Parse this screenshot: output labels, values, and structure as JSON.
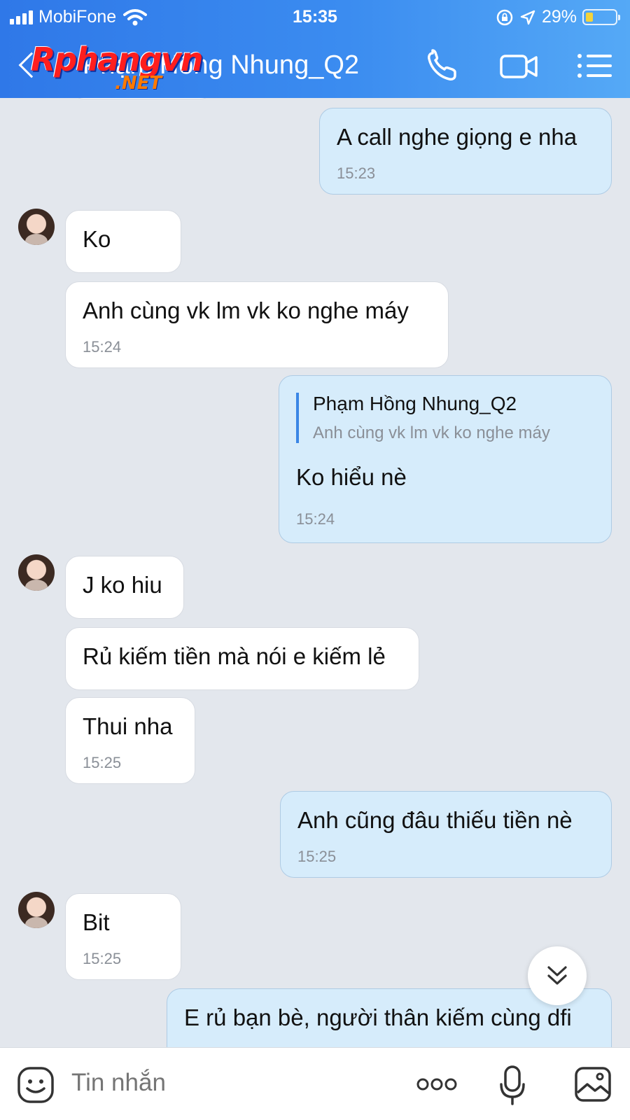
{
  "status_bar": {
    "carrier": "MobiFone",
    "time": "15:35",
    "battery": "29%"
  },
  "header": {
    "title": "Phạm Hồng Nhung_Q2",
    "watermark_main": "Rphangvn",
    "watermark_sub": ".NET"
  },
  "messages": [
    {
      "side": "out",
      "text": "A call nghe giọng e nha",
      "time": "15:23"
    },
    {
      "side": "in",
      "text": "Ko"
    },
    {
      "side": "in",
      "text": "Anh cùng vk lm vk ko nghe máy",
      "time": "15:24"
    },
    {
      "side": "out",
      "quote_name": "Phạm Hồng Nhung_Q2",
      "quote_text": "Anh cùng vk lm vk ko nghe máy",
      "text": "Ko hiểu nè",
      "time": "15:24"
    },
    {
      "side": "in",
      "text": "J ko hiu"
    },
    {
      "side": "in",
      "text": "Rủ kiếm tiền mà nói e kiếm lẻ"
    },
    {
      "side": "in",
      "text": "Thui nha",
      "time": "15:25"
    },
    {
      "side": "out",
      "text": "Anh cũng đâu thiếu tiền nè",
      "time": "15:25"
    },
    {
      "side": "in",
      "text": "Bit",
      "time": "15:25"
    },
    {
      "side": "out",
      "text": "E rủ bạn bè, người thân kiếm cùng dfi"
    }
  ],
  "input": {
    "placeholder": "Tin nhắn"
  },
  "colors": {
    "header_start": "#2f78e8",
    "header_end": "#55a9f6",
    "outgoing_bubble": "#d6ecfb",
    "incoming_bubble": "#ffffff"
  },
  "icons": [
    "back-icon",
    "phone-icon",
    "video-call-icon",
    "menu-list-icon",
    "scroll-down-icon",
    "sticker-icon",
    "more-dots-icon",
    "microphone-icon",
    "gallery-icon"
  ]
}
